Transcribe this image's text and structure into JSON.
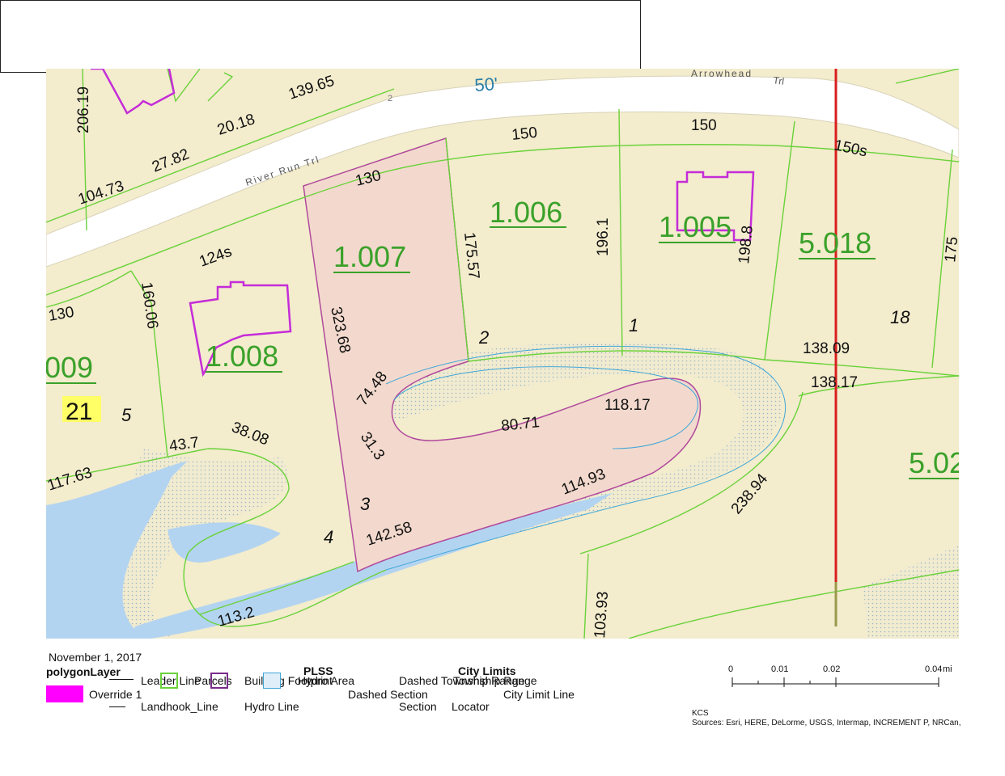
{
  "map": {
    "road_labels": {
      "arrowhead": "Arrowhead",
      "arrowhead_suffix": "Trl",
      "river_run": "River Run Trl",
      "route_number": "50'",
      "small_number": "2"
    },
    "parcel_ids": [
      "1.006",
      "1.007",
      "1.005",
      "5.018",
      "1.008",
      "009",
      "5.02"
    ],
    "dimensions": [
      "206.19",
      "139.65",
      "20.18",
      "27.82",
      "104.73",
      "150",
      "150",
      "150s",
      "130",
      "175.57",
      "196.1",
      "198.8",
      "175",
      "124s",
      "160.06",
      "130",
      "323.68",
      "138.09",
      "138.17",
      "74.48",
      "31.3",
      "80.71",
      "118.17",
      "43.7",
      "38.08",
      "117.63",
      "114.93",
      "238.94",
      "142.58",
      "113.2",
      "103.93"
    ],
    "lot_numbers": [
      "2",
      "1",
      "18",
      "21",
      "5",
      "3",
      "4"
    ],
    "colors": {
      "land": "#f3eccd",
      "road": "#ffffff",
      "water": "#b3d4f0",
      "parcel_line": "#6ad23a",
      "building": "#c52cd8",
      "subject_fill": "#f3d9cd",
      "city_limit": "#d81f1f",
      "lot21_highlight": "#ffff66"
    }
  },
  "legend": {
    "date": "November 1, 2017",
    "layer_title": "polygonLayer",
    "override": "Override 1",
    "leader_line": "Leader Line",
    "landhook_line": "Landhook_Line",
    "parcels": "Parcels",
    "building_footprint": "Building Footprint",
    "hydro_area": "Hydro Area",
    "hydro_line": "Hydro Line",
    "plss_title": "PLSS",
    "dashed_section": "Dashed Section",
    "section": "Section",
    "dashed_township": "Dashed Township Range",
    "township_range": "Township Range",
    "locator": "Locator",
    "city_limits_title": "City Limits",
    "city_limit_line": "City Limit Line"
  },
  "scale": {
    "ticks": [
      "0",
      "0.01",
      "0.02",
      "0.04"
    ],
    "unit": "mi"
  },
  "credits": {
    "org": "KCS",
    "sources": "Sources: Esri, HERE, DeLorme, USGS, Intermap, INCREMENT P, NRCan,"
  }
}
